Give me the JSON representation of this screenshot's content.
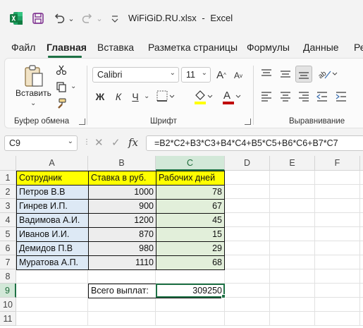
{
  "titlebar": {
    "filename": "WiFiGiD.RU.xlsx",
    "app_name": "Excel",
    "separator": "-",
    "dropdown_glyph": "⌄"
  },
  "tabs": [
    {
      "label": "Файл"
    },
    {
      "label": "Главная",
      "active": true
    },
    {
      "label": "Вставка"
    },
    {
      "label": "Разметка страницы"
    },
    {
      "label": "Формулы"
    },
    {
      "label": "Данные"
    },
    {
      "label": "Ре"
    }
  ],
  "ribbon": {
    "clipboard": {
      "paste_label": "Вставить",
      "group_label": "Буфер обмена"
    },
    "font": {
      "font_name": "Calibri",
      "font_size": "11",
      "bold": "Ж",
      "italic": "К",
      "underline": "Ч",
      "group_label": "Шрифт",
      "font_color": "#c00000",
      "fill_color": "#ffff00"
    },
    "alignment": {
      "group_label": "Выравнивание"
    }
  },
  "formula_bar": {
    "name_box": "C9",
    "fx_label": "fx",
    "formula": "=B2*C2+B3*C3+B4*C4+B5*C5+B6*C6+B7*C7"
  },
  "grid": {
    "columns": [
      "A",
      "B",
      "C",
      "D",
      "E",
      "F"
    ],
    "rows": [
      "1",
      "2",
      "3",
      "4",
      "5",
      "6",
      "7",
      "8",
      "9",
      "10",
      "11"
    ],
    "headers": [
      "Сотрудник",
      "Ставка в руб.",
      "Рабочих дней"
    ],
    "data": [
      [
        "Петров В.В",
        "1000",
        "78"
      ],
      [
        "Гинрев И.П.",
        "900",
        "67"
      ],
      [
        "Вадимова А.И.",
        "1200",
        "45"
      ],
      [
        "Иванов И.И.",
        "870",
        "15"
      ],
      [
        "Демидов П.В",
        "980",
        "29"
      ],
      [
        "Муратова А.П.",
        "1110",
        "68"
      ]
    ],
    "total_label": "Всего выплат:",
    "total_value": "309250"
  },
  "colors": {
    "accent": "#1e7145",
    "header_fill": "#ffff00",
    "name_fill": "#dde9f5",
    "rate_fill": "#ededed",
    "days_fill": "#e2efda"
  }
}
